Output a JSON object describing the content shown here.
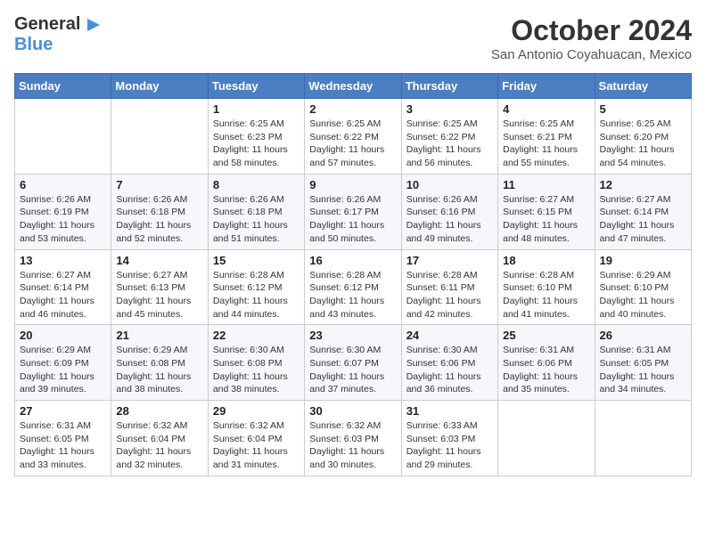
{
  "header": {
    "logo_general": "General",
    "logo_blue": "Blue",
    "month_title": "October 2024",
    "location": "San Antonio Coyahuacan, Mexico"
  },
  "calendar": {
    "days_of_week": [
      "Sunday",
      "Monday",
      "Tuesday",
      "Wednesday",
      "Thursday",
      "Friday",
      "Saturday"
    ],
    "weeks": [
      [
        {
          "day": "",
          "info": ""
        },
        {
          "day": "",
          "info": ""
        },
        {
          "day": "1",
          "info": "Sunrise: 6:25 AM\nSunset: 6:23 PM\nDaylight: 11 hours and 58 minutes."
        },
        {
          "day": "2",
          "info": "Sunrise: 6:25 AM\nSunset: 6:22 PM\nDaylight: 11 hours and 57 minutes."
        },
        {
          "day": "3",
          "info": "Sunrise: 6:25 AM\nSunset: 6:22 PM\nDaylight: 11 hours and 56 minutes."
        },
        {
          "day": "4",
          "info": "Sunrise: 6:25 AM\nSunset: 6:21 PM\nDaylight: 11 hours and 55 minutes."
        },
        {
          "day": "5",
          "info": "Sunrise: 6:25 AM\nSunset: 6:20 PM\nDaylight: 11 hours and 54 minutes."
        }
      ],
      [
        {
          "day": "6",
          "info": "Sunrise: 6:26 AM\nSunset: 6:19 PM\nDaylight: 11 hours and 53 minutes."
        },
        {
          "day": "7",
          "info": "Sunrise: 6:26 AM\nSunset: 6:18 PM\nDaylight: 11 hours and 52 minutes."
        },
        {
          "day": "8",
          "info": "Sunrise: 6:26 AM\nSunset: 6:18 PM\nDaylight: 11 hours and 51 minutes."
        },
        {
          "day": "9",
          "info": "Sunrise: 6:26 AM\nSunset: 6:17 PM\nDaylight: 11 hours and 50 minutes."
        },
        {
          "day": "10",
          "info": "Sunrise: 6:26 AM\nSunset: 6:16 PM\nDaylight: 11 hours and 49 minutes."
        },
        {
          "day": "11",
          "info": "Sunrise: 6:27 AM\nSunset: 6:15 PM\nDaylight: 11 hours and 48 minutes."
        },
        {
          "day": "12",
          "info": "Sunrise: 6:27 AM\nSunset: 6:14 PM\nDaylight: 11 hours and 47 minutes."
        }
      ],
      [
        {
          "day": "13",
          "info": "Sunrise: 6:27 AM\nSunset: 6:14 PM\nDaylight: 11 hours and 46 minutes."
        },
        {
          "day": "14",
          "info": "Sunrise: 6:27 AM\nSunset: 6:13 PM\nDaylight: 11 hours and 45 minutes."
        },
        {
          "day": "15",
          "info": "Sunrise: 6:28 AM\nSunset: 6:12 PM\nDaylight: 11 hours and 44 minutes."
        },
        {
          "day": "16",
          "info": "Sunrise: 6:28 AM\nSunset: 6:12 PM\nDaylight: 11 hours and 43 minutes."
        },
        {
          "day": "17",
          "info": "Sunrise: 6:28 AM\nSunset: 6:11 PM\nDaylight: 11 hours and 42 minutes."
        },
        {
          "day": "18",
          "info": "Sunrise: 6:28 AM\nSunset: 6:10 PM\nDaylight: 11 hours and 41 minutes."
        },
        {
          "day": "19",
          "info": "Sunrise: 6:29 AM\nSunset: 6:10 PM\nDaylight: 11 hours and 40 minutes."
        }
      ],
      [
        {
          "day": "20",
          "info": "Sunrise: 6:29 AM\nSunset: 6:09 PM\nDaylight: 11 hours and 39 minutes."
        },
        {
          "day": "21",
          "info": "Sunrise: 6:29 AM\nSunset: 6:08 PM\nDaylight: 11 hours and 38 minutes."
        },
        {
          "day": "22",
          "info": "Sunrise: 6:30 AM\nSunset: 6:08 PM\nDaylight: 11 hours and 38 minutes."
        },
        {
          "day": "23",
          "info": "Sunrise: 6:30 AM\nSunset: 6:07 PM\nDaylight: 11 hours and 37 minutes."
        },
        {
          "day": "24",
          "info": "Sunrise: 6:30 AM\nSunset: 6:06 PM\nDaylight: 11 hours and 36 minutes."
        },
        {
          "day": "25",
          "info": "Sunrise: 6:31 AM\nSunset: 6:06 PM\nDaylight: 11 hours and 35 minutes."
        },
        {
          "day": "26",
          "info": "Sunrise: 6:31 AM\nSunset: 6:05 PM\nDaylight: 11 hours and 34 minutes."
        }
      ],
      [
        {
          "day": "27",
          "info": "Sunrise: 6:31 AM\nSunset: 6:05 PM\nDaylight: 11 hours and 33 minutes."
        },
        {
          "day": "28",
          "info": "Sunrise: 6:32 AM\nSunset: 6:04 PM\nDaylight: 11 hours and 32 minutes."
        },
        {
          "day": "29",
          "info": "Sunrise: 6:32 AM\nSunset: 6:04 PM\nDaylight: 11 hours and 31 minutes."
        },
        {
          "day": "30",
          "info": "Sunrise: 6:32 AM\nSunset: 6:03 PM\nDaylight: 11 hours and 30 minutes."
        },
        {
          "day": "31",
          "info": "Sunrise: 6:33 AM\nSunset: 6:03 PM\nDaylight: 11 hours and 29 minutes."
        },
        {
          "day": "",
          "info": ""
        },
        {
          "day": "",
          "info": ""
        }
      ]
    ]
  }
}
